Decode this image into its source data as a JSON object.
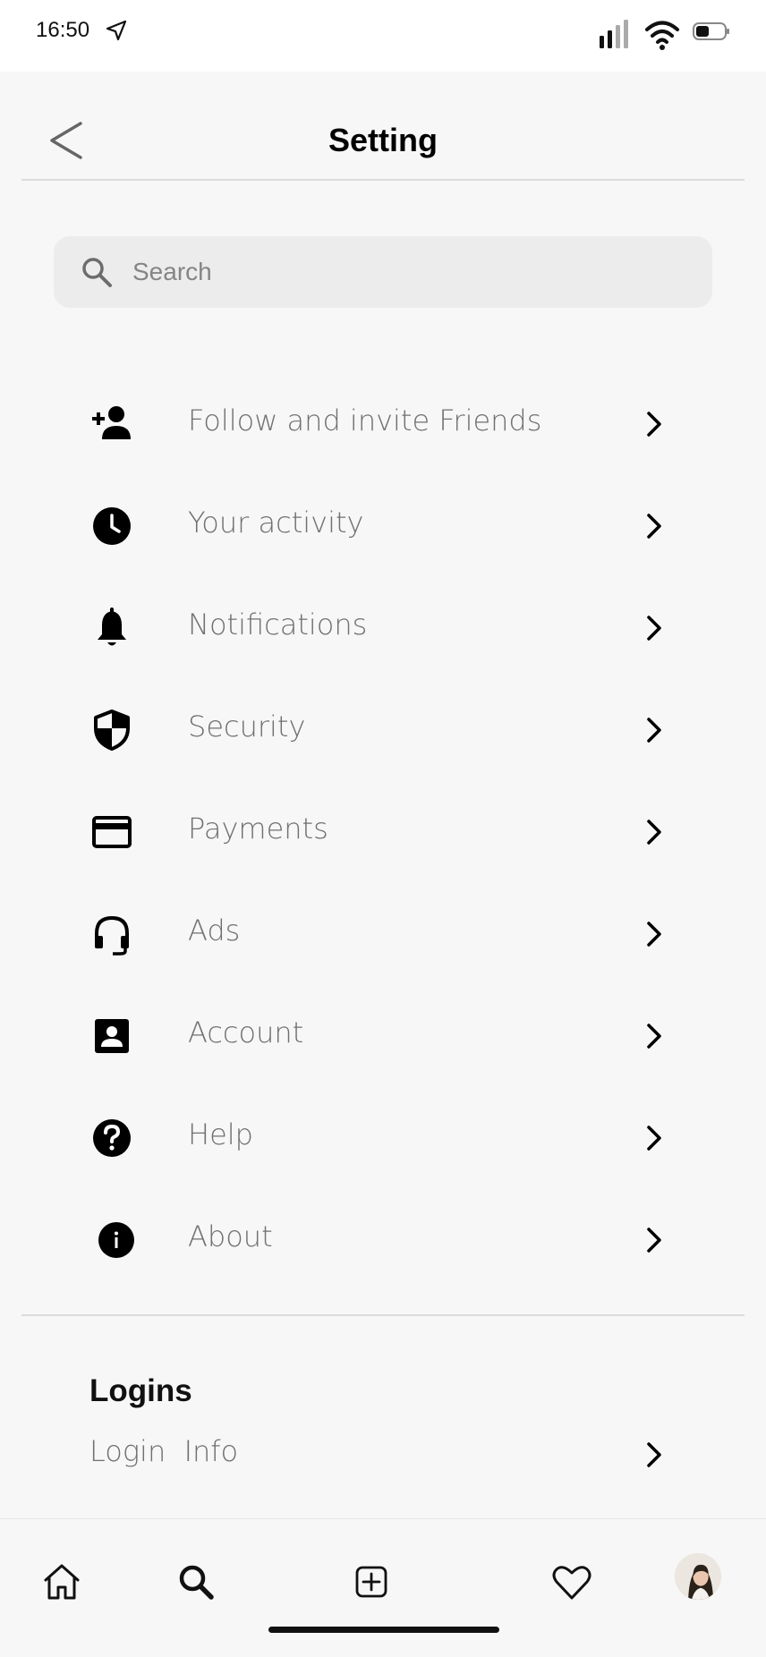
{
  "status_bar": {
    "time": "16:50",
    "icons": [
      "location-arrow-icon",
      "signal-icon",
      "wifi-icon",
      "battery-icon"
    ]
  },
  "header": {
    "title": "Setting",
    "back_icon": "chevron-left-icon"
  },
  "search": {
    "placeholder": "Search",
    "value": ""
  },
  "settings": {
    "items": [
      {
        "label": "Follow and invite Friends",
        "icon": "person-add-icon"
      },
      {
        "label": "Your activity",
        "icon": "clock-icon"
      },
      {
        "label": "Notifications",
        "icon": "bell-icon"
      },
      {
        "label": "Security",
        "icon": "shield-icon"
      },
      {
        "label": "Payments",
        "icon": "credit-card-icon"
      },
      {
        "label": "Ads",
        "icon": "headset-icon"
      },
      {
        "label": "Account",
        "icon": "account-box-icon"
      },
      {
        "label": "Help",
        "icon": "help-icon"
      },
      {
        "label": "About",
        "icon": "info-icon"
      }
    ]
  },
  "logins": {
    "section_title": "Logins",
    "items": [
      {
        "label": "Login  Info"
      }
    ]
  },
  "tab_bar": {
    "tabs": [
      "home-icon",
      "search-icon",
      "add-post-icon",
      "heart-icon",
      "profile-avatar"
    ]
  },
  "colors": {
    "background": "#f7f7f7",
    "label": "#707070",
    "search_field": "#ececec",
    "divider": "#dcdcdc"
  }
}
